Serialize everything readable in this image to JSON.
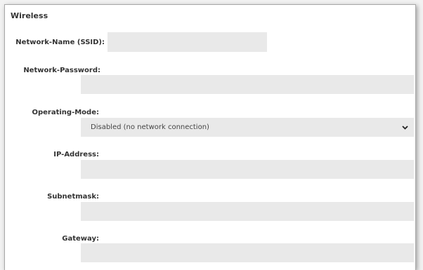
{
  "wireless": {
    "title": "Wireless",
    "fields": {
      "ssid": {
        "label": "Network-Name (SSID):",
        "value": ""
      },
      "password": {
        "label": "Network-Password:",
        "value": ""
      },
      "operating_mode": {
        "label": "Operating-Mode:",
        "selected": "Disabled (no network connection)"
      },
      "ip_address": {
        "label": "IP-Address:",
        "value": ""
      },
      "subnetmask": {
        "label": "Subnetmask:",
        "value": ""
      },
      "gateway": {
        "label": "Gateway:",
        "value": ""
      }
    }
  },
  "icons": {
    "dropdown": "chevron-down-icon"
  },
  "colors": {
    "field_background": "#e9e9e9",
    "text": "#333333"
  }
}
